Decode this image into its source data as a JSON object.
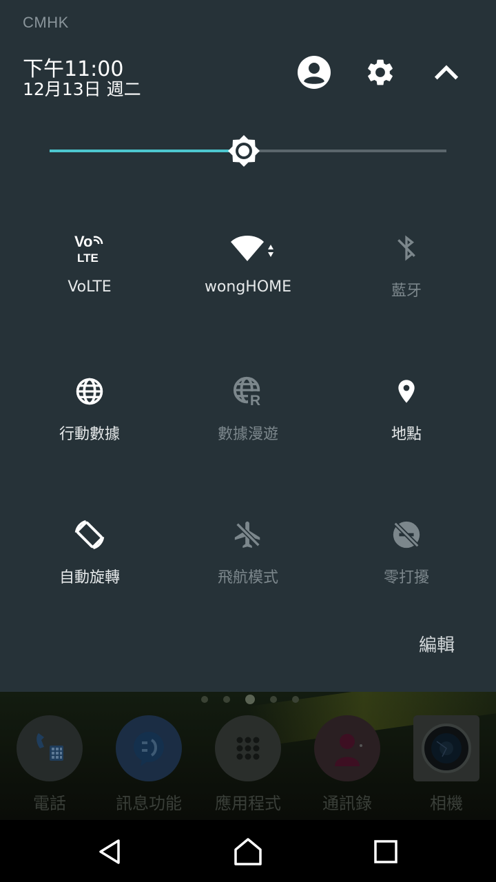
{
  "status": {
    "carrier": "CMHK"
  },
  "header": {
    "time": "下午11:00",
    "date": "12月13日 週二",
    "icons": [
      "account-icon",
      "settings-icon",
      "collapse-icon"
    ]
  },
  "brightness": {
    "level_percent": 49
  },
  "tiles": [
    {
      "label": "VoLTE",
      "icon": "volte-icon",
      "enabled": true,
      "icon_text_top": "Vo",
      "icon_text_bottom": "LTE"
    },
    {
      "label": "wongHOME",
      "icon": "wifi-icon",
      "enabled": true
    },
    {
      "label": "藍牙",
      "icon": "bluetooth-off-icon",
      "enabled": false
    },
    {
      "label": "行動數據",
      "icon": "mobile-data-icon",
      "enabled": true
    },
    {
      "label": "數據漫遊",
      "icon": "data-roaming-icon",
      "enabled": false,
      "icon_text": "R"
    },
    {
      "label": "地點",
      "icon": "location-icon",
      "enabled": true
    },
    {
      "label": "自動旋轉",
      "icon": "auto-rotate-icon",
      "enabled": true
    },
    {
      "label": "飛航模式",
      "icon": "airplane-mode-icon",
      "enabled": false
    },
    {
      "label": "零打擾",
      "icon": "do-not-disturb-icon",
      "enabled": false
    }
  ],
  "edit_label": "編輯",
  "home": {
    "page_dots": 5,
    "active_dot": 2,
    "apps": [
      {
        "label": "電話",
        "icon": "phone-icon"
      },
      {
        "label": "訊息功能",
        "icon": "messaging-icon"
      },
      {
        "label": "應用程式",
        "icon": "apps-icon"
      },
      {
        "label": "通訊錄",
        "icon": "contacts-icon"
      },
      {
        "label": "相機",
        "icon": "camera-icon"
      }
    ]
  },
  "navbar": [
    "back-icon",
    "home-icon",
    "recents-icon"
  ],
  "colors": {
    "shade_bg": "#263238",
    "accent": "#4dc7cf",
    "dim": "#7c878c"
  }
}
